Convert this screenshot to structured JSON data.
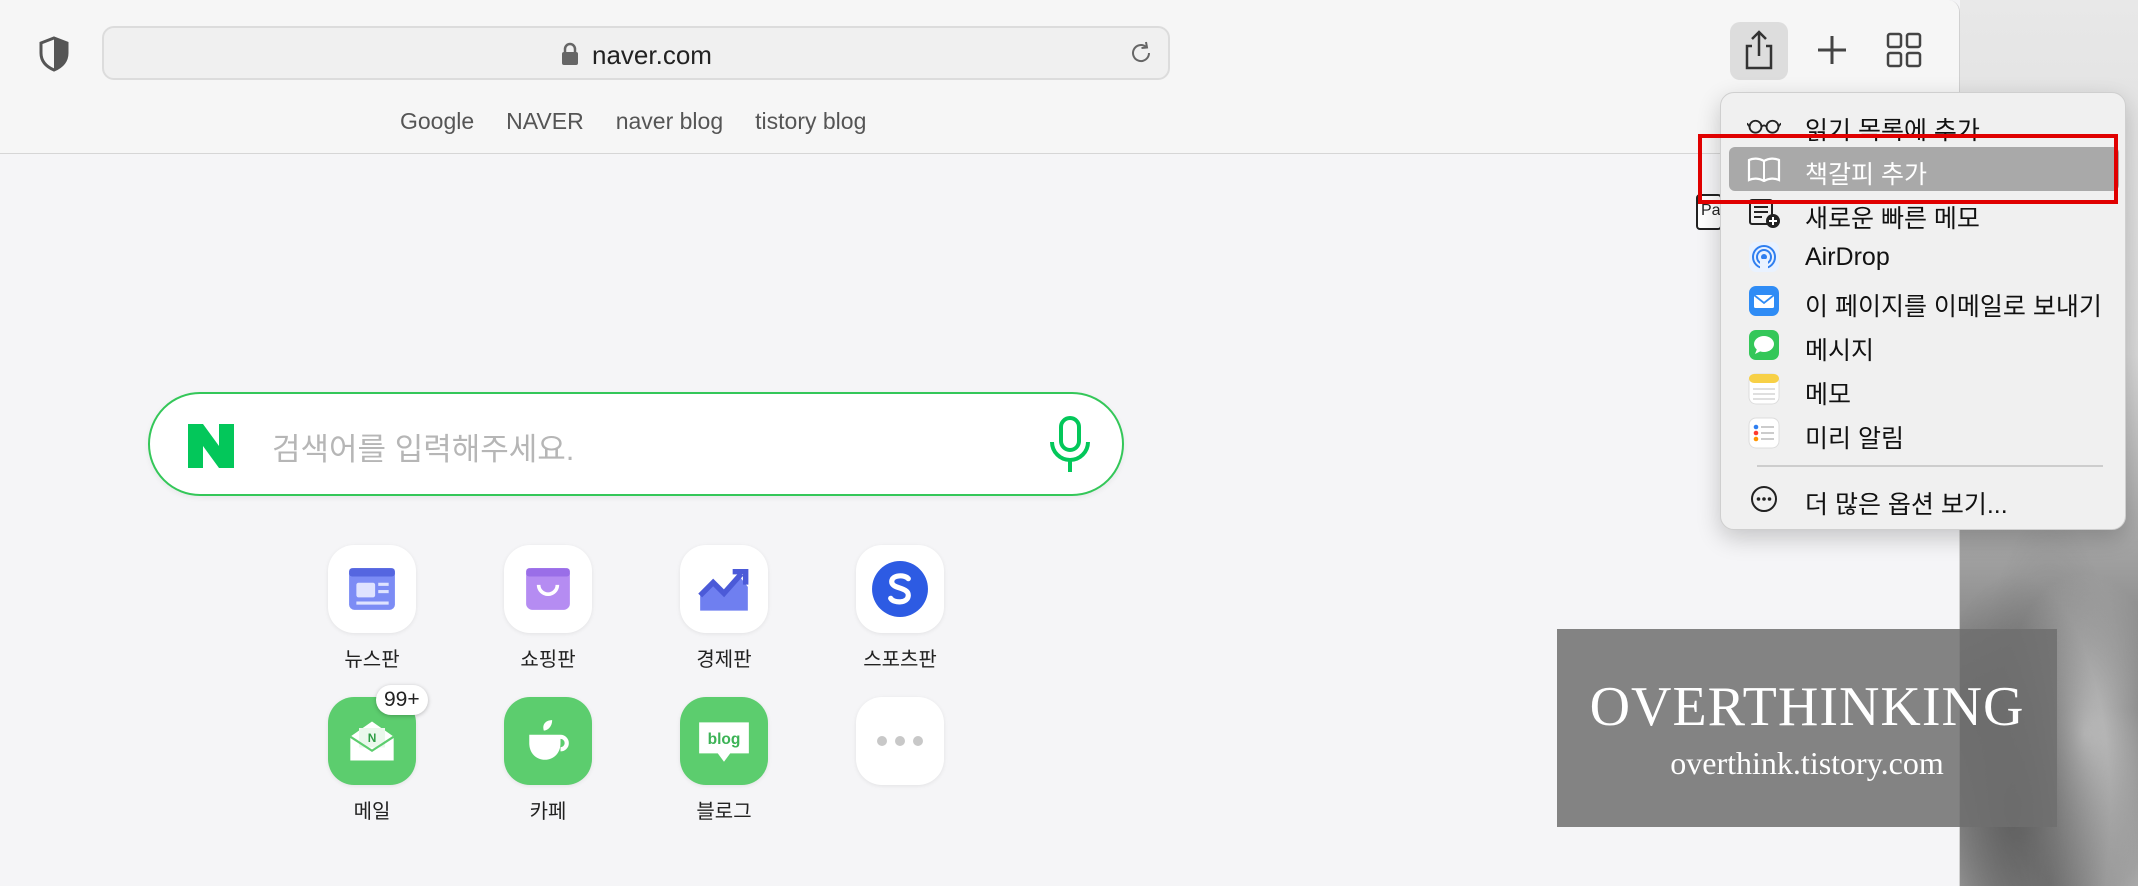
{
  "toolbar": {
    "url": "naver.com",
    "favorites": [
      "Google",
      "NAVER",
      "naver blog",
      "tistory blog"
    ]
  },
  "search": {
    "placeholder": "검색어를 입력해주세요."
  },
  "apps": [
    {
      "label": "뉴스판",
      "icon": "news-icon"
    },
    {
      "label": "쇼핑판",
      "icon": "shopping-bag-icon"
    },
    {
      "label": "경제판",
      "icon": "chart-up-icon"
    },
    {
      "label": "스포츠판",
      "icon": "sports-s-icon"
    },
    {
      "label": "메일",
      "icon": "mail-icon",
      "badge": "99+"
    },
    {
      "label": "카페",
      "icon": "cafe-cup-icon"
    },
    {
      "label": "블로그",
      "icon": "blog-icon"
    },
    {
      "label": "",
      "icon": "more-dots-icon"
    }
  ],
  "menu": {
    "items": [
      {
        "label": "읽기 목록에 추가",
        "icon": "glasses-icon"
      },
      {
        "label": "책갈피 추가",
        "icon": "book-icon",
        "highlighted": true
      },
      {
        "label": "새로운 빠른 메모",
        "icon": "quick-note-icon"
      },
      {
        "label": "AirDrop",
        "icon": "airdrop-icon"
      },
      {
        "label": "이 페이지를 이메일로 보내기",
        "icon": "mail-app-icon"
      },
      {
        "label": "메시지",
        "icon": "messages-icon"
      },
      {
        "label": "메모",
        "icon": "notes-icon"
      },
      {
        "label": "미리 알림",
        "icon": "reminders-icon"
      }
    ],
    "more": {
      "label": "더 많은 옵션 보기...",
      "icon": "ellipsis-circle-icon"
    }
  },
  "peek_text": "Pa",
  "watermark": {
    "title": "OVERTHINKING",
    "url": "overthink.tistory.com"
  },
  "colors": {
    "naver_green": "#03c75a",
    "highlight": "#a9a9a9",
    "annotation_red": "#e00000"
  }
}
